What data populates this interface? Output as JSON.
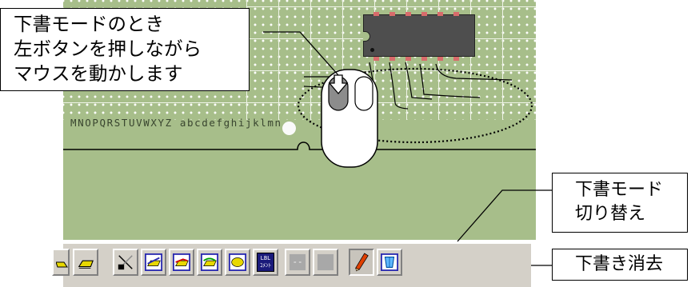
{
  "board": {
    "coordinate_letters": "MNOPQRSTUVWXYZ abcdefghijklmn"
  },
  "callouts": {
    "drafting_mode_lines": [
      "下書モードのとき",
      "左ボタンを押しながら",
      "マウスを動かします"
    ],
    "toggle_lines": [
      "下書モード",
      "切り替え"
    ],
    "erase_label": "下書き消去"
  },
  "toolbar": {
    "buttons": [
      {
        "name": "draw-tool",
        "icon": "pencil-area-icon"
      },
      {
        "name": "layer-tool",
        "icon": "layer-icon"
      },
      {
        "name": "wire-cut-tool",
        "icon": "wire-cut-icon"
      },
      {
        "name": "wire-blue-tool",
        "icon": "wire-icon"
      },
      {
        "name": "wire-red-tool",
        "icon": "wire-red-icon"
      },
      {
        "name": "wire-green-tool",
        "icon": "wire-green-icon"
      },
      {
        "name": "pad-tool",
        "icon": "pad-icon"
      },
      {
        "name": "label-comment-tool",
        "icon": "label-comment-icon"
      },
      {
        "name": "disabled-tool-a",
        "icon": "disabled-icon"
      },
      {
        "name": "disabled-tool-b",
        "icon": "disabled-icon"
      },
      {
        "name": "draft-mode-toggle",
        "icon": "pencil-icon"
      },
      {
        "name": "draft-erase",
        "icon": "eraser-icon"
      }
    ],
    "lbl_icon_text_top": "LBL",
    "lbl_icon_text_bottom": "ｺﾒﾝﾄ"
  },
  "colors": {
    "board": "#a7be8a",
    "trace": "#eef3e6",
    "ic_body": "#4e4e4e",
    "ic_pin": "#d86b6b",
    "toolbar": "#d4d0c8"
  }
}
